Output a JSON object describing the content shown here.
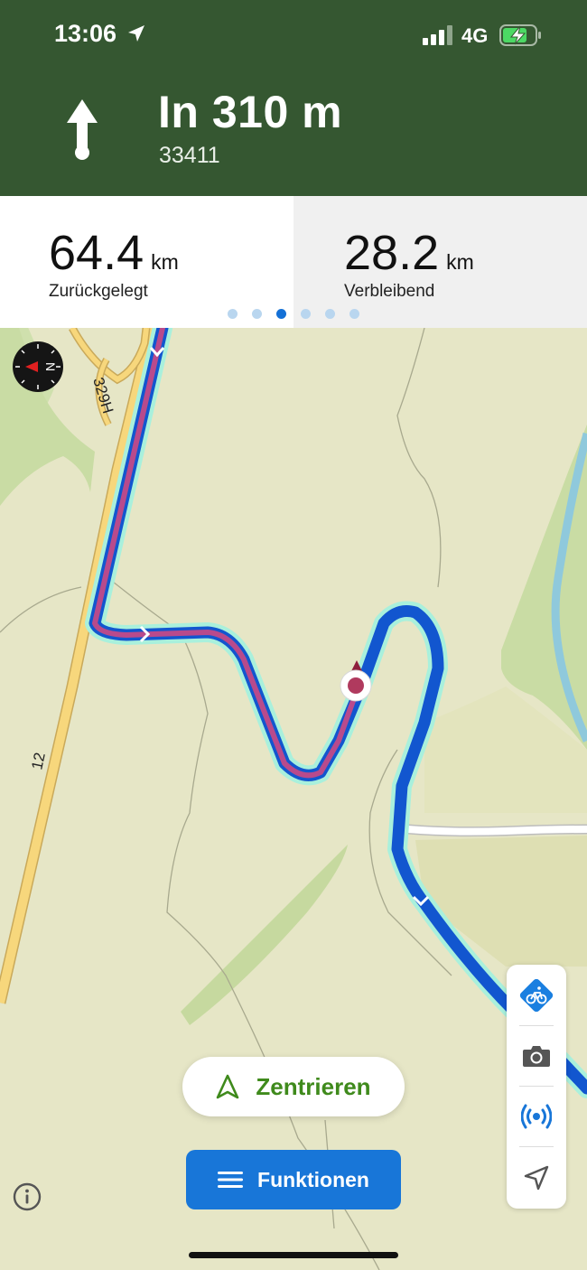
{
  "status_bar": {
    "time": "13:06",
    "network": "4G",
    "icons": [
      "location-arrow-icon",
      "signal-bars-icon",
      "battery-charging-icon"
    ]
  },
  "navigation": {
    "maneuver_icon": "arrow-straight-icon",
    "distance": "In 310 m",
    "street": "33411"
  },
  "stats": {
    "traveled": {
      "value": "64.4",
      "unit": "km",
      "label": "Zurückgelegt"
    },
    "remaining": {
      "value": "28.2",
      "unit": "km",
      "label": "Verbleibend"
    },
    "pages": {
      "count": 6,
      "active": 2
    }
  },
  "map": {
    "road_labels": {
      "h": "329H",
      "main": "12"
    },
    "compass_letter": "N",
    "route_colors": {
      "traveled": "#b84a8c",
      "remaining": "#1256cf",
      "halo": "#a9f0dc"
    },
    "map_colors": {
      "background": "#e6e6c6",
      "forest": "#c9dca4",
      "river": "#8fc9dc",
      "highway": "#f7d77c"
    }
  },
  "buttons": {
    "center": {
      "label": "Zentrieren",
      "icon": "navigation-arrow-outline-icon"
    },
    "functions": {
      "label": "Funktionen",
      "icon": "menu-icon"
    }
  },
  "toolbar": {
    "items": [
      {
        "icon": "bicycle-sign-icon"
      },
      {
        "icon": "camera-icon"
      },
      {
        "icon": "live-tracking-icon"
      },
      {
        "icon": "location-arrow-icon"
      }
    ]
  },
  "colors": {
    "header": "#355731",
    "accent_blue": "#1876d8",
    "accent_green": "#3f8a1c"
  }
}
